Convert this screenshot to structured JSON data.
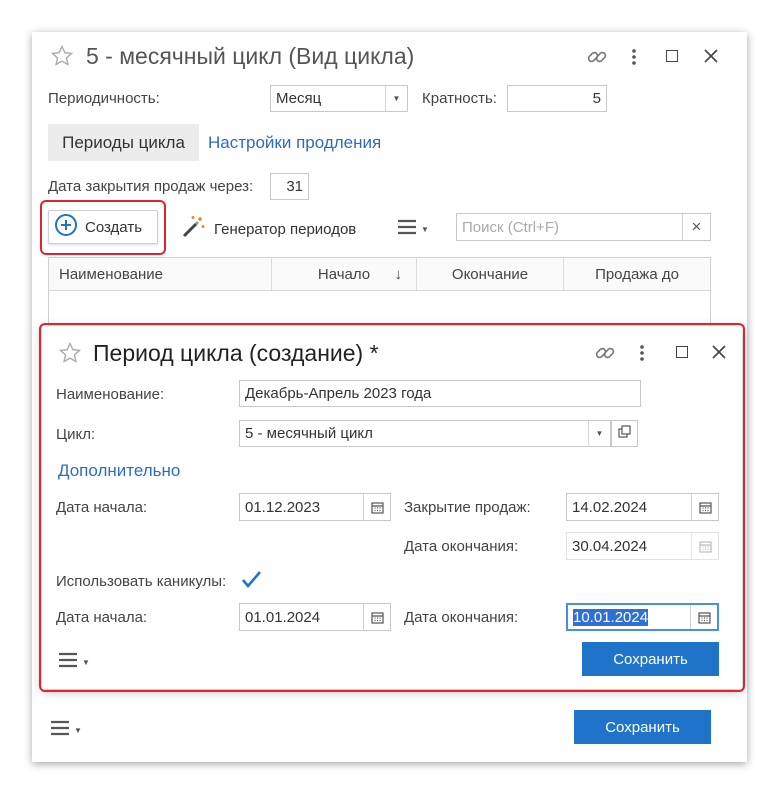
{
  "outer": {
    "title": "5 - месячный цикл (Вид цикла)",
    "periodicity_label": "Периодичность:",
    "periodicity_value": "Месяц",
    "multiplicity_label": "Кратность:",
    "multiplicity_value": "5",
    "tabs": [
      "Периоды цикла",
      "Настройки продления"
    ],
    "close_sales_label": "Дата закрытия продаж через:",
    "close_sales_value": "31",
    "create_label": "Создать",
    "generator_label": "Генератор периодов",
    "search_placeholder": "Поиск (Ctrl+F)",
    "search_clear": "×",
    "table_headers": [
      "Наименование",
      "Начало",
      "Окончание",
      "Продажа до"
    ],
    "sort_arrow": "↓",
    "save_label": "Сохранить"
  },
  "inner": {
    "title": "Период цикла (создание) *",
    "name_label": "Наименование:",
    "name_value": "Декабрь-Апрель 2023 года",
    "cycle_label": "Цикл:",
    "cycle_value": "5 - месячный цикл",
    "additional_link": "Дополнительно",
    "start_label": "Дата начала:",
    "start_value": "01.12.2023",
    "close_label": "Закрытие продаж:",
    "close_value": "14.02.2024",
    "end_label": "Дата окончания:",
    "end_value": "30.04.2024",
    "holidays_label": "Использовать каникулы:",
    "holidays_checked": true,
    "hol_start_label": "Дата начала:",
    "hol_start_value": "01.01.2024",
    "hol_end_label": "Дата окончания:",
    "hol_end_value": "10.01.2024",
    "save_label": "Сохранить"
  },
  "colors": {
    "accent": "#1f73c9",
    "link": "#2b6cc4",
    "highlight": "#e0242e",
    "selection": "#2f6fd6"
  },
  "icons": [
    "star-icon",
    "link-icon",
    "more-vert-icon",
    "maximize-icon",
    "close-icon",
    "plus-circle-icon",
    "magic-wand-icon",
    "hamburger-menu-icon",
    "dropdown-arrow-icon",
    "calendar-icon",
    "open-window-icon",
    "checkmark-icon"
  ]
}
